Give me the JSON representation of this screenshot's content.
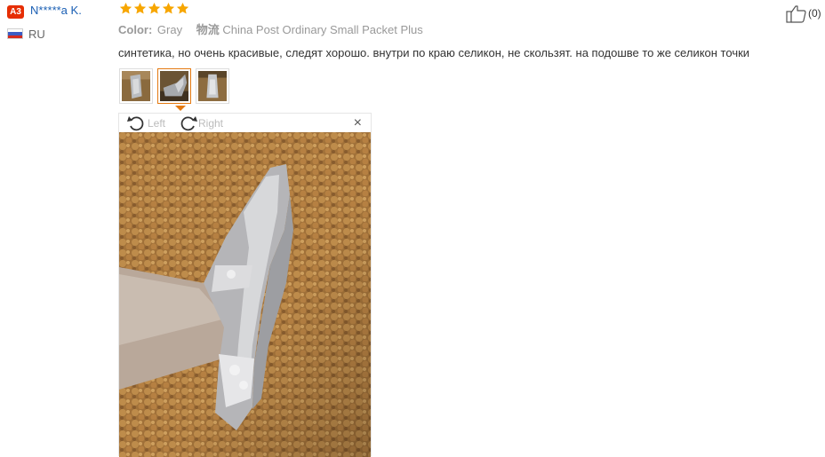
{
  "reviewer": {
    "badge": "А3",
    "name": "N*****a K.",
    "country_code": "RU"
  },
  "rating": {
    "stars": 5,
    "max": 5,
    "color": "#f7a600"
  },
  "attributes": {
    "color_label": "Color:",
    "color_value": "Gray",
    "shipping_cn": "物流",
    "shipping_value": "China Post Ordinary Small Packet Plus"
  },
  "review_text": "синтетика, но очень красивые, следят хорошо. внутри по краю селикон, не скользят. на подошве то же селикон точки",
  "thumbnails": [
    {
      "icon": "photo-thumbnail",
      "active": false
    },
    {
      "icon": "photo-thumbnail",
      "active": true
    },
    {
      "icon": "photo-thumbnail",
      "active": false
    }
  ],
  "viewer": {
    "rotate_left_label": "Left",
    "rotate_right_label": "Right",
    "close_icon": "close-icon",
    "close_glyph": "×"
  },
  "helpful": {
    "icon": "thumbs-up-icon",
    "count_text": "(0)"
  },
  "colors": {
    "accent": "#e47911",
    "link": "#1a5fb4",
    "badge": "#e62e04"
  }
}
